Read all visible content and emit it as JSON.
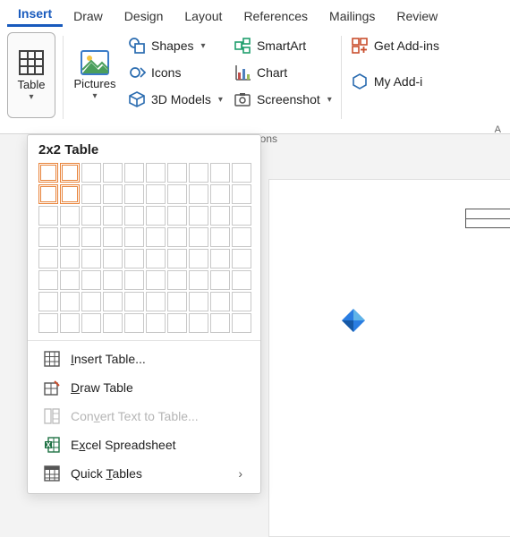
{
  "tabs": {
    "insert": "Insert",
    "draw": "Draw",
    "design": "Design",
    "layout": "Layout",
    "references": "References",
    "mailings": "Mailings",
    "review": "Review"
  },
  "ribbon": {
    "table": "Table",
    "pictures": "Pictures",
    "shapes": "Shapes",
    "icons": "Icons",
    "models3d": "3D Models",
    "smartart": "SmartArt",
    "chart": "Chart",
    "screenshot": "Screenshot",
    "getaddins": "Get Add-ins",
    "myaddins": "My Add-i",
    "addins_group": "A",
    "ions_partial": "ions"
  },
  "dropdown": {
    "title": "2x2 Table",
    "grid": {
      "cols": 10,
      "rows": 8,
      "sel_cols": 2,
      "sel_rows": 2
    },
    "insert_table": "Insert Table...",
    "draw_table": "Draw Table",
    "convert": "Convert Text to Table...",
    "excel": "Excel Spreadsheet",
    "quick": "Quick Tables"
  }
}
